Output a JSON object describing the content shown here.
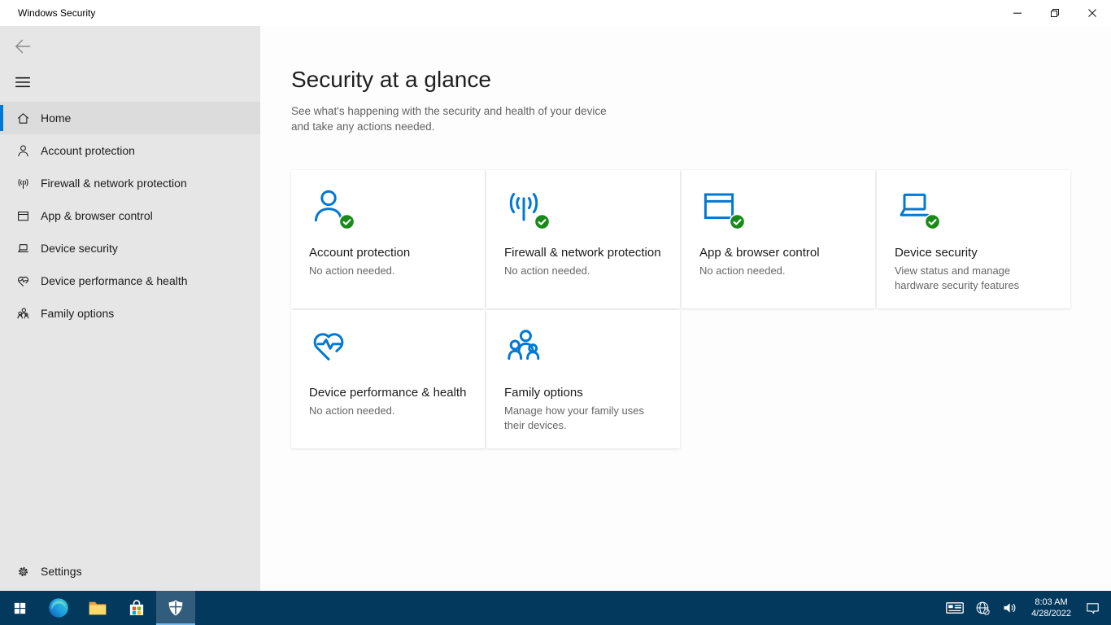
{
  "window": {
    "title": "Windows Security",
    "controls": {
      "minimize_icon": "minimize-icon",
      "restore_icon": "restore-icon",
      "close_icon": "close-icon"
    }
  },
  "sidebar": {
    "back_icon": "back-arrow-icon",
    "menu_icon": "hamburger-menu-icon",
    "items": [
      {
        "label": "Home",
        "icon": "home-icon",
        "selected": true
      },
      {
        "label": "Account protection",
        "icon": "person-icon",
        "selected": false
      },
      {
        "label": "Firewall & network protection",
        "icon": "antenna-icon",
        "selected": false
      },
      {
        "label": "App & browser control",
        "icon": "browser-icon",
        "selected": false
      },
      {
        "label": "Device security",
        "icon": "laptop-icon",
        "selected": false
      },
      {
        "label": "Device performance & health",
        "icon": "heart-pulse-icon",
        "selected": false
      },
      {
        "label": "Family options",
        "icon": "family-icon",
        "selected": false
      }
    ],
    "settings": {
      "label": "Settings",
      "icon": "gear-icon"
    }
  },
  "main": {
    "title": "Security at a glance",
    "subtitle": "See what's happening with the security and health of your device and take any actions needed.",
    "cards": [
      {
        "title": "Account protection",
        "description": "No action needed.",
        "icon": "person-icon",
        "status_ok": true
      },
      {
        "title": "Firewall & network protection",
        "description": "No action needed.",
        "icon": "antenna-icon",
        "status_ok": true
      },
      {
        "title": "App & browser control",
        "description": "No action needed.",
        "icon": "browser-icon",
        "status_ok": true
      },
      {
        "title": "Device security",
        "description": "View status and manage hardware security features",
        "icon": "laptop-icon",
        "status_ok": true
      },
      {
        "title": "Device performance & health",
        "description": "No action needed.",
        "icon": "heart-pulse-icon",
        "status_ok": false
      },
      {
        "title": "Family options",
        "description": "Manage how your family uses their devices.",
        "icon": "family-icon",
        "status_ok": false
      }
    ]
  },
  "taskbar": {
    "apps": [
      {
        "name": "start",
        "icon": "windows-logo-icon",
        "size": 17,
        "active": false
      },
      {
        "name": "edge",
        "icon": "edge-icon",
        "size": 28,
        "active": false
      },
      {
        "name": "file-explorer",
        "icon": "folder-icon",
        "size": 26,
        "active": false
      },
      {
        "name": "microsoft-store",
        "icon": "store-icon",
        "size": 26,
        "active": false
      },
      {
        "name": "windows-security",
        "icon": "defender-shield-icon",
        "size": 24,
        "active": true
      }
    ],
    "tray": {
      "icons": [
        {
          "name": "touch-keyboard",
          "icon": "keyboard-icon",
          "size": 24
        },
        {
          "name": "network-no-internet",
          "icon": "globe-offline-icon",
          "size": 19
        },
        {
          "name": "volume",
          "icon": "volume-icon",
          "size": 20
        }
      ],
      "clock": {
        "time": "8:03 AM",
        "date": "4/28/2022"
      },
      "action_center_icon": "notification-icon"
    }
  },
  "colors": {
    "accent_blue": "#0078d4",
    "status_green": "#188a18",
    "taskbar_blue": "#04395e",
    "sidebar_gray": "#e6e6e6"
  }
}
